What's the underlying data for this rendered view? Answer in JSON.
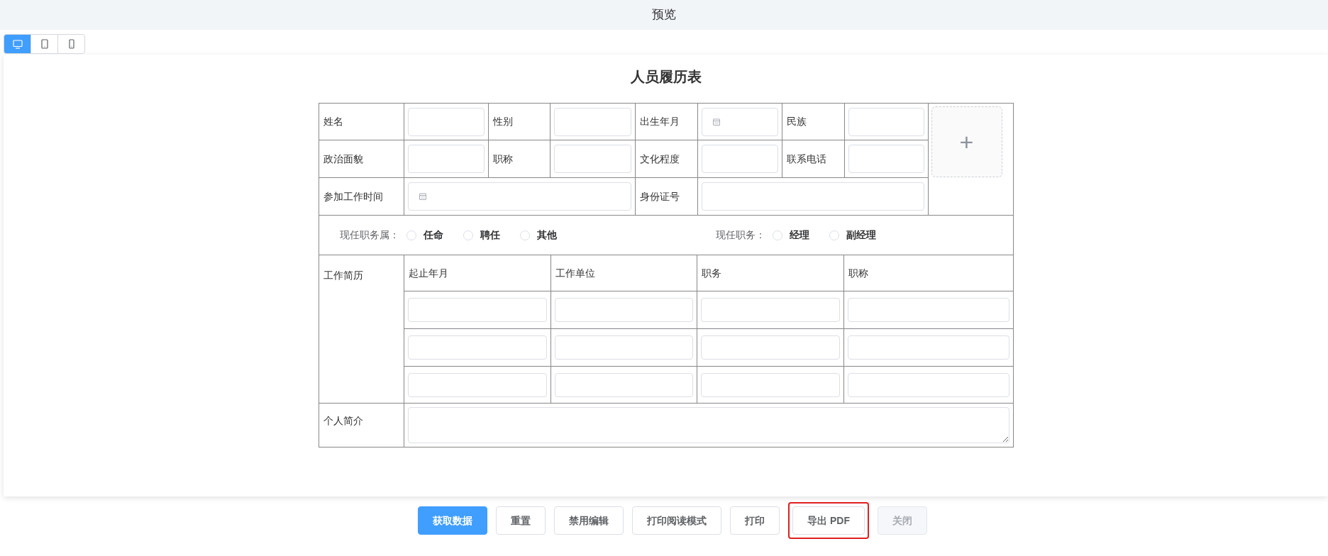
{
  "header": {
    "title": "预览"
  },
  "device_tabs": [
    {
      "kind": "desktop",
      "selected": true
    },
    {
      "kind": "tablet",
      "selected": false
    },
    {
      "kind": "phone",
      "selected": false
    }
  ],
  "form": {
    "title": "人员履历表",
    "rows": [
      {
        "cells": [
          {
            "kind": "label",
            "text": "姓名"
          },
          {
            "kind": "input"
          },
          {
            "kind": "label",
            "text": "性别"
          },
          {
            "kind": "input"
          },
          {
            "kind": "label",
            "text": "出生年月"
          },
          {
            "kind": "date"
          },
          {
            "kind": "label",
            "text": "民族"
          },
          {
            "kind": "input"
          }
        ]
      },
      {
        "cells": [
          {
            "kind": "label",
            "text": "政治面貌"
          },
          {
            "kind": "input"
          },
          {
            "kind": "label",
            "text": "职称"
          },
          {
            "kind": "input"
          },
          {
            "kind": "label",
            "text": "文化程度"
          },
          {
            "kind": "input"
          },
          {
            "kind": "label",
            "text": "联系电话"
          },
          {
            "kind": "input"
          }
        ]
      },
      {
        "cells": [
          {
            "kind": "label",
            "text": "参加工作时间"
          },
          {
            "kind": "date",
            "colspan": 3
          },
          {
            "kind": "label",
            "text": "身份证号"
          },
          {
            "kind": "input",
            "colspan": 3
          }
        ]
      }
    ],
    "photo_upload": {
      "symbol": "+"
    },
    "radio_groups": [
      {
        "label": "现任职务属：",
        "options": [
          {
            "label": "任命",
            "selected": false
          },
          {
            "label": "聘任",
            "selected": false
          },
          {
            "label": "其他",
            "selected": false
          }
        ]
      },
      {
        "label": "现任职务：",
        "options": [
          {
            "label": "经理",
            "selected": false
          },
          {
            "label": "副经理",
            "selected": false
          }
        ]
      }
    ],
    "work_history": {
      "label": "工作简历",
      "columns": [
        "起止年月",
        "工作单位",
        "职务",
        "职称"
      ],
      "rows": [
        {
          "cells": [
            {
              "kind": "input"
            },
            {
              "kind": "input"
            },
            {
              "kind": "input"
            },
            {
              "kind": "input"
            }
          ]
        },
        {
          "cells": [
            {
              "kind": "input"
            },
            {
              "kind": "input"
            },
            {
              "kind": "input"
            },
            {
              "kind": "input"
            }
          ]
        },
        {
          "cells": [
            {
              "kind": "input"
            },
            {
              "kind": "input"
            },
            {
              "kind": "input"
            },
            {
              "kind": "input"
            }
          ]
        }
      ]
    },
    "profile": {
      "label": "个人简介"
    }
  },
  "buttons": [
    {
      "label": "获取数据",
      "kind": "primary",
      "disabled": false,
      "highlighted": false
    },
    {
      "label": "重置",
      "kind": "default",
      "disabled": false,
      "highlighted": false
    },
    {
      "label": "禁用编辑",
      "kind": "default",
      "disabled": false,
      "highlighted": false
    },
    {
      "label": "打印阅读模式",
      "kind": "default",
      "disabled": false,
      "highlighted": false
    },
    {
      "label": "打印",
      "kind": "default",
      "disabled": false,
      "highlighted": false
    },
    {
      "label": "导出 PDF",
      "kind": "default",
      "disabled": false,
      "highlighted": true
    },
    {
      "label": "关闭",
      "kind": "default",
      "disabled": true,
      "highlighted": false
    }
  ]
}
